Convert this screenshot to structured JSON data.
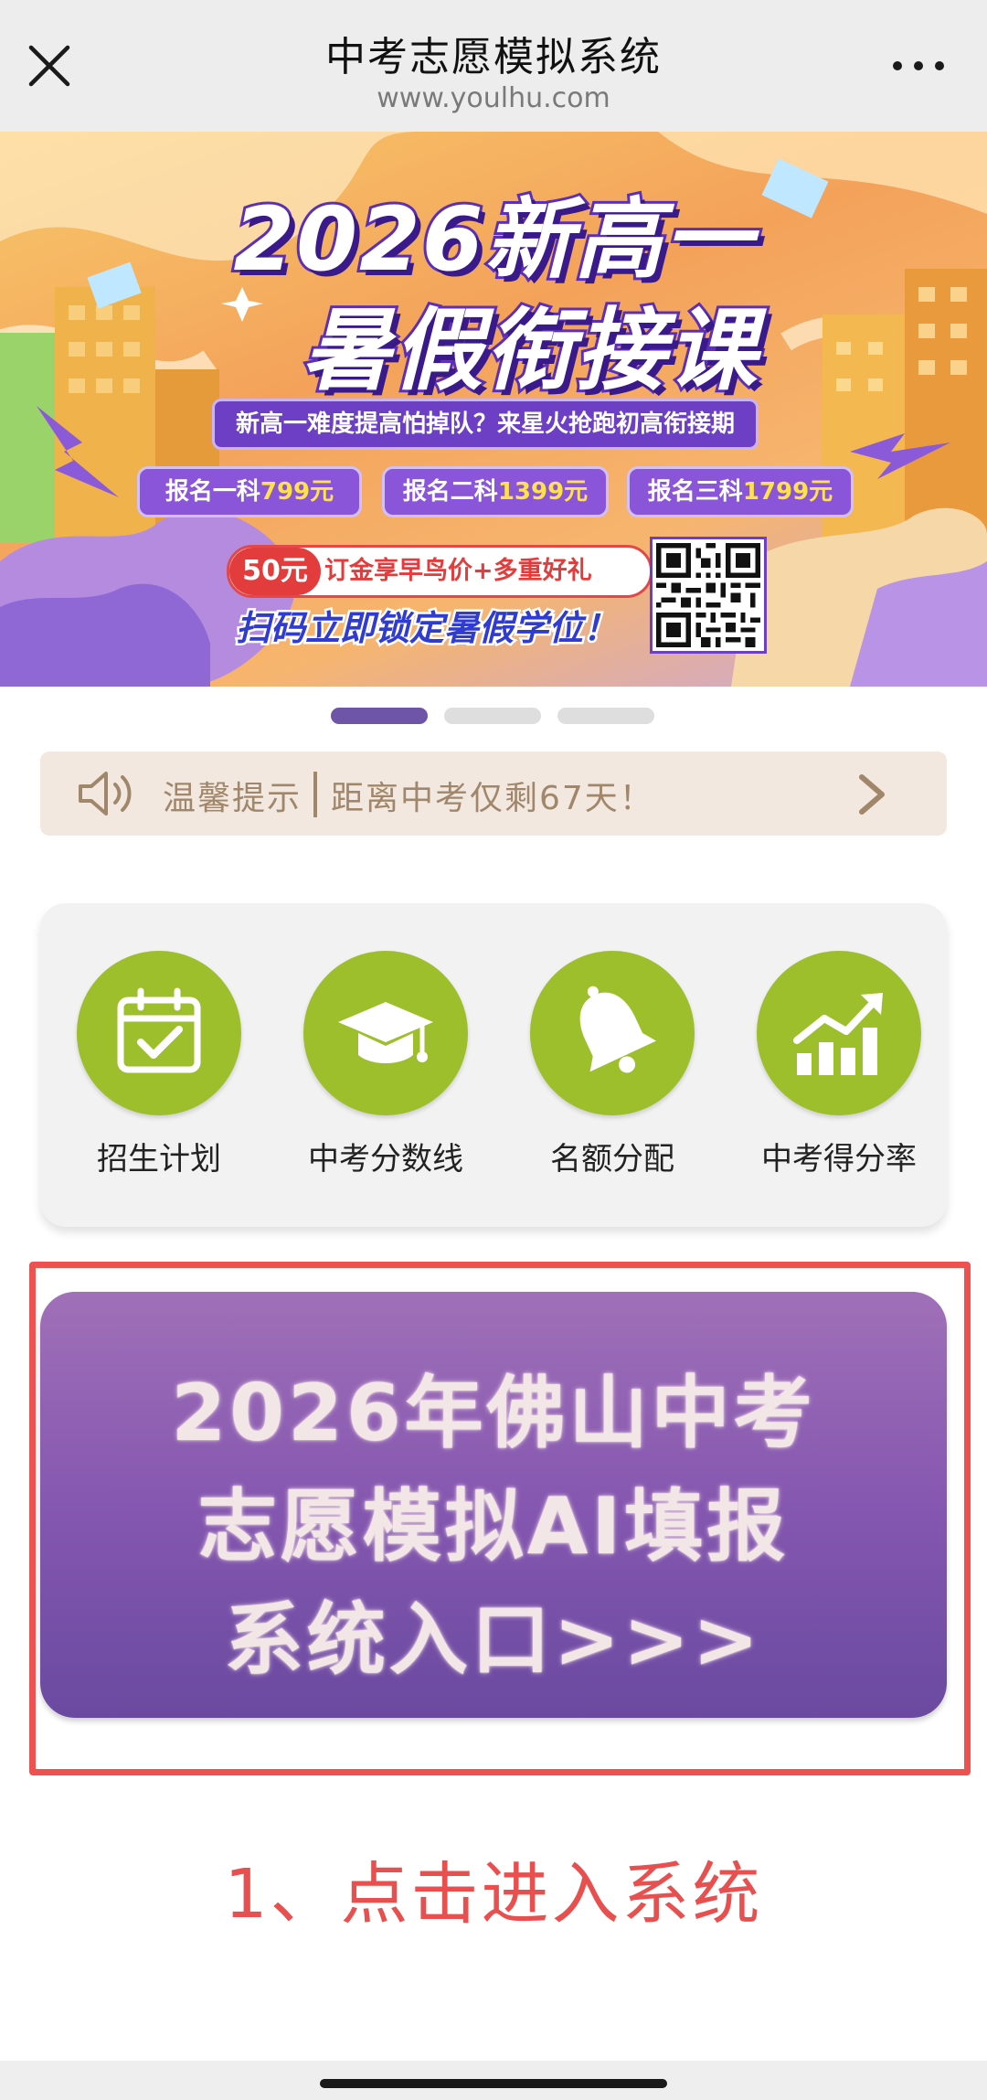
{
  "nav": {
    "title": "中考志愿模拟系统",
    "url": "www.youlhu.com",
    "close_icon": "close-icon",
    "more_icon": "more-dots-icon"
  },
  "banner": {
    "headline_line1": "2026新高一",
    "headline_line2": "暑假衔接课",
    "subtitle": "新高一难度提高怕掉队？来星火抢跑初高衔接期",
    "prices": [
      {
        "label": "报名一科",
        "price": "799元"
      },
      {
        "label": "报名二科",
        "price": "1399元"
      },
      {
        "label": "报名三科",
        "price": "1799元"
      }
    ],
    "promo_badge": "50元",
    "promo_text": "订金享早鸟价+多重好礼",
    "scan_text": "扫码立即锁定暑假学位！",
    "qr_icon": "qr-code-icon"
  },
  "carousel": {
    "slide_count": 3,
    "active_index": 0,
    "active_color": "#6f55a8",
    "inactive_color": "#dedede"
  },
  "notice": {
    "label": "温馨提示",
    "text": "距离中考仅剩67天！",
    "speaker_icon": "speaker-icon",
    "arrow_icon": "chevron-right-icon"
  },
  "menu": {
    "accent_color": "#9cbf2b",
    "items": [
      {
        "label": "招生计划",
        "icon": "calendar-check-icon"
      },
      {
        "label": "中考分数线",
        "icon": "graduation-cap-icon"
      },
      {
        "label": "名额分配",
        "icon": "bell-icon"
      },
      {
        "label": "中考得分率",
        "icon": "bar-chart-trend-icon"
      }
    ]
  },
  "cta": {
    "line1": "2026年佛山中考",
    "line2": "志愿模拟AI填报",
    "line3": "系统入口>>>",
    "highlight_color": "#ef5050"
  },
  "instruction": "1、点击进入系统"
}
